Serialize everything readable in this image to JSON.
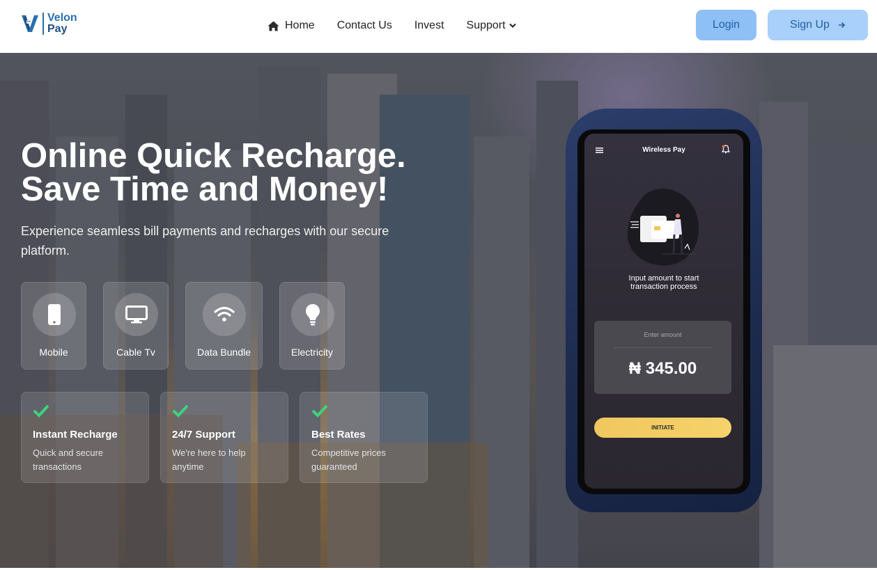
{
  "brand": {
    "name_line1": "Velon",
    "name_line2": "Pay",
    "colors": {
      "primary": "#2a6fb0",
      "accent_gold": "#f0c75e",
      "check_green": "#3fd37a"
    }
  },
  "nav": {
    "home": "Home",
    "contact": "Contact Us",
    "invest": "Invest",
    "support": "Support",
    "icons": {
      "home": "home-icon",
      "support_dropdown": "chevron-down-icon"
    }
  },
  "auth": {
    "login": "Login",
    "signup": "Sign Up"
  },
  "hero": {
    "title_line1": "Online Quick Recharge.",
    "title_line2": "Save Time and Money!",
    "subtitle": "Experience seamless bill payments and recharges with our secure platform."
  },
  "services": [
    {
      "label": "Mobile",
      "icon": "mobile-phone-icon"
    },
    {
      "label": "Cable Tv",
      "icon": "tv-monitor-icon"
    },
    {
      "label": "Data Bundle",
      "icon": "wifi-icon"
    },
    {
      "label": "Electricity",
      "icon": "lightbulb-icon"
    }
  ],
  "features": [
    {
      "title": "Instant Recharge",
      "desc": "Quick and secure transactions"
    },
    {
      "title": "24/7 Support",
      "desc": "We're here to help anytime"
    },
    {
      "title": "Best Rates",
      "desc": "Competitive prices guaranteed"
    }
  ],
  "phone": {
    "app_title": "Wireless Pay",
    "caption_line1": "Input amount  to start",
    "caption_line2": "transaction process",
    "amount_placeholder": "Enter amount",
    "amount": "₦ 345.00",
    "button": "INITIATE"
  }
}
